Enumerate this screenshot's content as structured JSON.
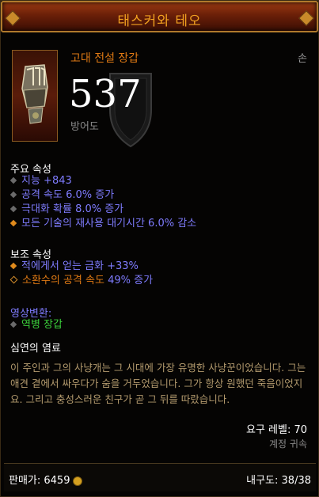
{
  "header": {
    "title": "태스커와 테오"
  },
  "item": {
    "name": "고대 전설 장갑",
    "slot": "손",
    "armor_value": "537",
    "armor_label": "방어도",
    "icon": "gauntlet-icon"
  },
  "primary": {
    "heading": "주요 속성",
    "stats": [
      {
        "text": "지능 +843"
      },
      {
        "text": "공격 속도 6.0% 증가"
      },
      {
        "text": "극대화 확률 8.0% 증가"
      },
      {
        "text": "모든 기술의 재사용 대기시간 6.0% 감소"
      }
    ]
  },
  "secondary": {
    "heading": "보조 속성",
    "stats": [
      {
        "text": "적에게서 얻는 금화 +33%"
      },
      {
        "prefix": "소환수의 공격 속도",
        "value": "49% 증가"
      }
    ]
  },
  "transmog": {
    "heading": "영상변환:",
    "value": "역병 장갑"
  },
  "flavor": {
    "heading": "심연의 염료",
    "text": "이 주인과 그의 사냥개는 그 시대에 가장 유명한 사냥꾼이었습니다. 그는 애견 곁에서 싸우다가 숨을 거두었습니다. 그가 항상 원했던 죽음이었지요. 그리고 충성스러운 친구가 곧 그 뒤를 따랐습니다."
  },
  "requirements": {
    "level": "요구 레벨: 70",
    "bound": "계정 귀속"
  },
  "footer": {
    "sell": "판매가: 6459",
    "durability": "내구도: 38/38"
  },
  "colors": {
    "title": "#f0a020",
    "legendary": "#e07a14",
    "magic": "#7f7cff",
    "transmog_value": "#3cd23c",
    "flavor": "#b49b6e"
  }
}
